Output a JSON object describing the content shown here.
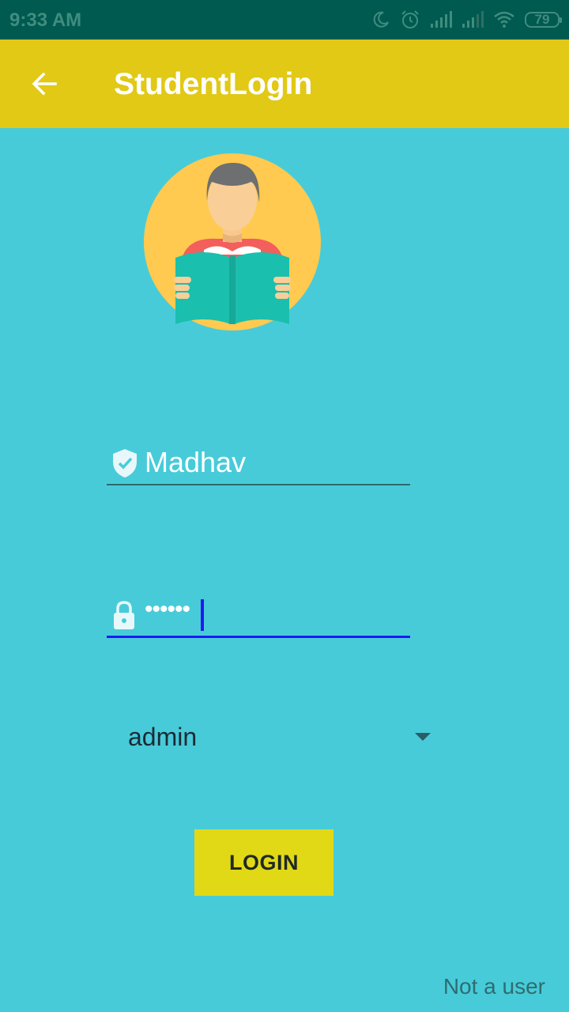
{
  "status_bar": {
    "time": "9:33 AM",
    "battery": "79",
    "icons": [
      "moon-icon",
      "alarm-icon",
      "signal-icon",
      "signal-icon",
      "wifi-icon",
      "battery-icon"
    ]
  },
  "app_bar": {
    "title": "StudentLogin",
    "back_icon": "arrow-back-icon",
    "background": "#e1c916"
  },
  "avatar": {
    "icon": "student-reading-avatar"
  },
  "username_field": {
    "icon": "verified-shield-icon",
    "value": "Madhav"
  },
  "password_field": {
    "icon": "lock-icon",
    "masked_value": "••••••",
    "focused": true
  },
  "role_spinner": {
    "selected": "admin"
  },
  "login_button": {
    "label": "LOGIN",
    "background": "#e1d916"
  },
  "register_link": {
    "label": "Not a user"
  },
  "colors": {
    "background": "#48cbd9",
    "status_bar": "#005a4f",
    "focus_underline": "#1b1bf0"
  }
}
